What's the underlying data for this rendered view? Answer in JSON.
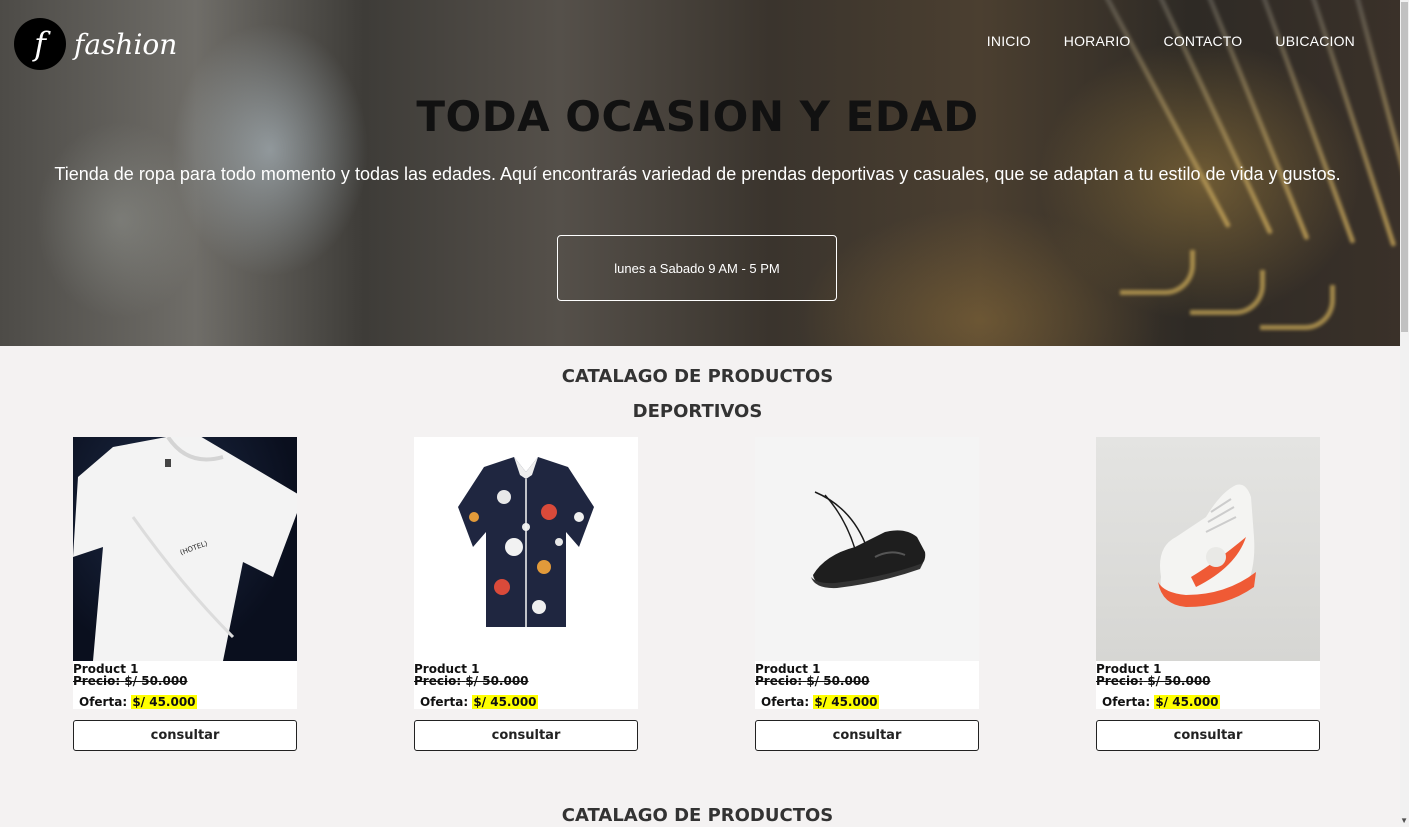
{
  "brand": {
    "logo_letter": "f",
    "name": "fashion"
  },
  "nav": {
    "items": [
      "INICIO",
      "HORARIO",
      "CONTACTO",
      "UBICACION"
    ]
  },
  "hero": {
    "title": "TODA OCASION Y EDAD",
    "text": "Tienda de ropa para todo momento y todas las edades. Aquí encontrarás variedad de prendas deportivas y casuales, que se adaptan a tu estilo de vida y gustos.",
    "hours": "lunes a Sabado 9 AM - 5 PM"
  },
  "catalog": {
    "title": "CATALAGO DE PRODUCTOS",
    "category": "DEPORTIVOS",
    "products": [
      {
        "name": "Product 1",
        "price_label": "Precio:",
        "price": "$/ 50.000",
        "offer_label": "Oferta:",
        "offer": "$/ 45.000",
        "button": "consultar",
        "image_icon": "white-tshirt-image"
      },
      {
        "name": "Product 1",
        "price_label": "Precio:",
        "price": "$/ 50.000",
        "offer_label": "Oferta:",
        "offer": "$/ 45.000",
        "button": "consultar",
        "image_icon": "floral-shirt-image"
      },
      {
        "name": "Product 1",
        "price_label": "Precio:",
        "price": "$/ 50.000",
        "offer_label": "Oferta:",
        "offer": "$/ 45.000",
        "button": "consultar",
        "image_icon": "black-sneaker-image"
      },
      {
        "name": "Product 1",
        "price_label": "Precio:",
        "price": "$/ 50.000",
        "offer_label": "Oferta:",
        "offer": "$/ 45.000",
        "button": "consultar",
        "image_icon": "orange-sneaker-image"
      }
    ],
    "next_title": "CATALAGO DE PRODUCTOS"
  },
  "colors": {
    "offer_highlight": "#ffff00",
    "background": "#f4f2f2",
    "text_dark": "#111111"
  }
}
